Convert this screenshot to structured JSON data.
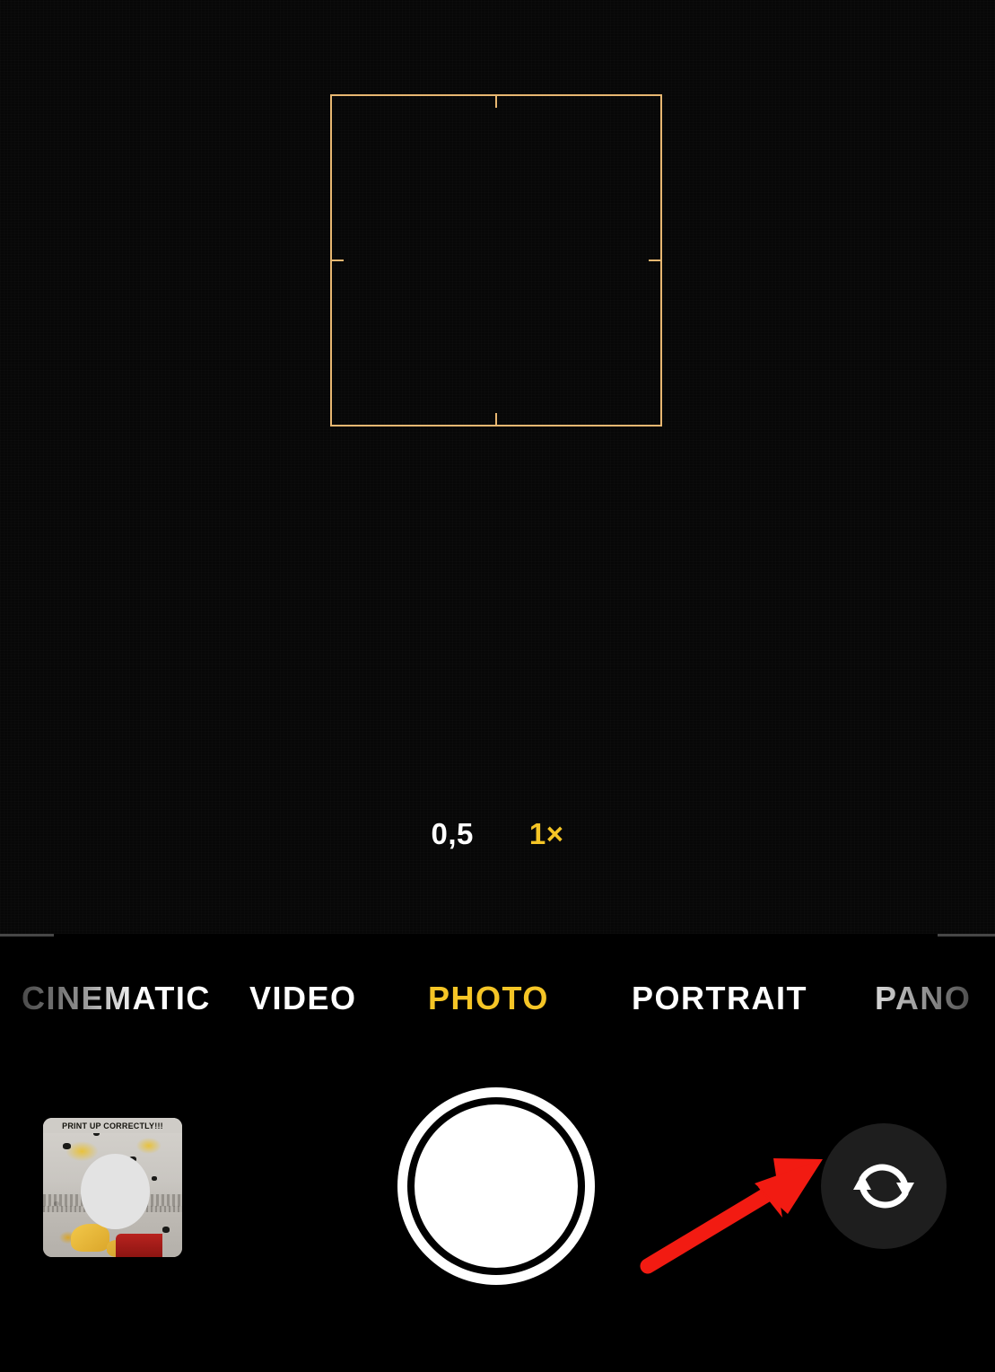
{
  "app": {
    "name": "Camera",
    "colors": {
      "accent_yellow": "#f5c526",
      "focus_square": "#e8b771",
      "annotation_red": "#f21b12",
      "shutter_white": "#ffffff",
      "flip_button_bg": "#1e1e1e",
      "divider_gray": "#474747",
      "viewfinder_bg": "#050505"
    }
  },
  "viewfinder": {
    "focus_square_name": "autofocus-frame",
    "background_description": "dark / black scene preview"
  },
  "zoom_controls": {
    "options": [
      {
        "label": "0,5",
        "value": "0.5",
        "active": false
      },
      {
        "label": "1×",
        "value": "1",
        "active": true
      }
    ]
  },
  "mode_selector": {
    "modes": [
      {
        "label": "CINEMATIC",
        "active": false,
        "style": "fade-left"
      },
      {
        "label": "VIDEO",
        "active": false,
        "style": "white"
      },
      {
        "label": "PHOTO",
        "active": true,
        "style": "active"
      },
      {
        "label": "PORTRAIT",
        "active": false,
        "style": "white"
      },
      {
        "label": "PANO",
        "active": false,
        "style": "fade-right"
      }
    ],
    "selected": "PHOTO"
  },
  "bottom_bar": {
    "thumbnail": {
      "name": "gallery-thumbnail",
      "caption_text": "PRINT UP CORRECTLY!!!",
      "description": "last captured photo preview"
    },
    "shutter": {
      "name": "shutter-button",
      "label": "Take Photo"
    },
    "flip_camera": {
      "name": "flip-camera-button",
      "icon": "camera-flip-icon",
      "label": "Switch Camera"
    }
  },
  "annotation": {
    "arrow": {
      "name": "instruction-arrow",
      "color": "#f21b12",
      "points_to": "flip-camera-button",
      "direction": "up-right"
    }
  }
}
